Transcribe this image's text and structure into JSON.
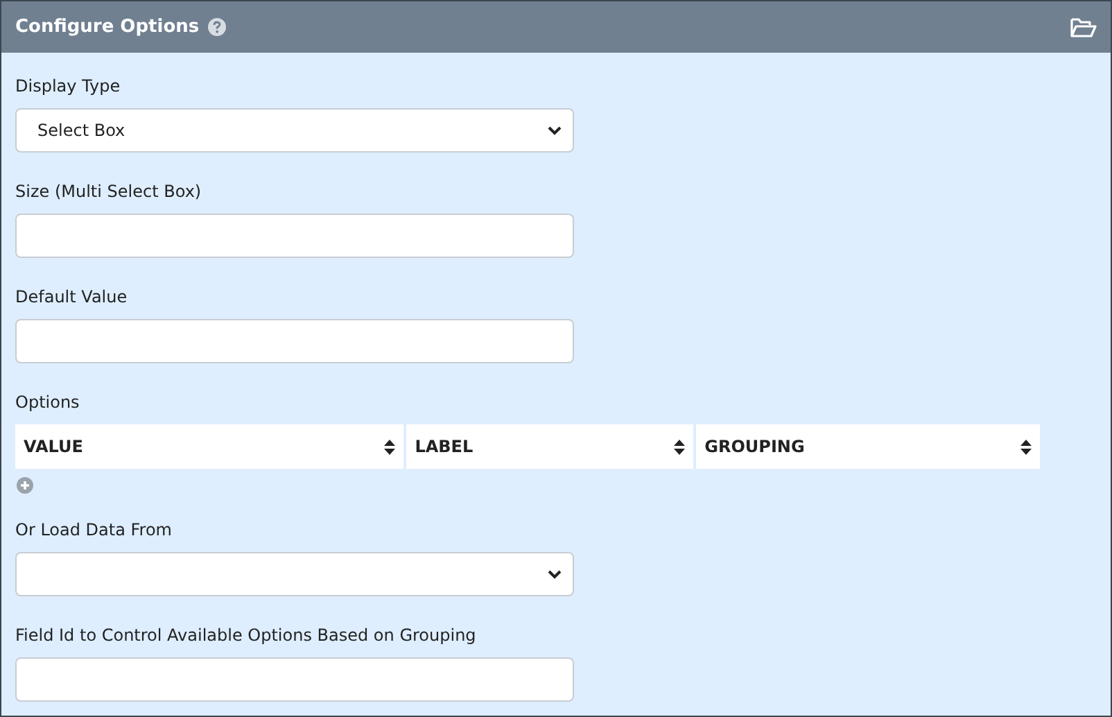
{
  "panel": {
    "title": "Configure Options"
  },
  "fields_top": [
    {
      "label": "Display Type",
      "kind": "select",
      "value": "Select Box"
    },
    {
      "label": "Size (Multi Select Box)",
      "kind": "input"
    },
    {
      "label": "Default Value",
      "kind": "input"
    }
  ],
  "options": {
    "label": "Options",
    "columns": [
      "VALUE",
      "LABEL",
      "GROUPING"
    ]
  },
  "fields_bottom": [
    {
      "label": "Or Load Data From",
      "kind": "select"
    },
    {
      "label": "Field Id to Control Available Options Based on Grouping",
      "kind": "input"
    }
  ]
}
